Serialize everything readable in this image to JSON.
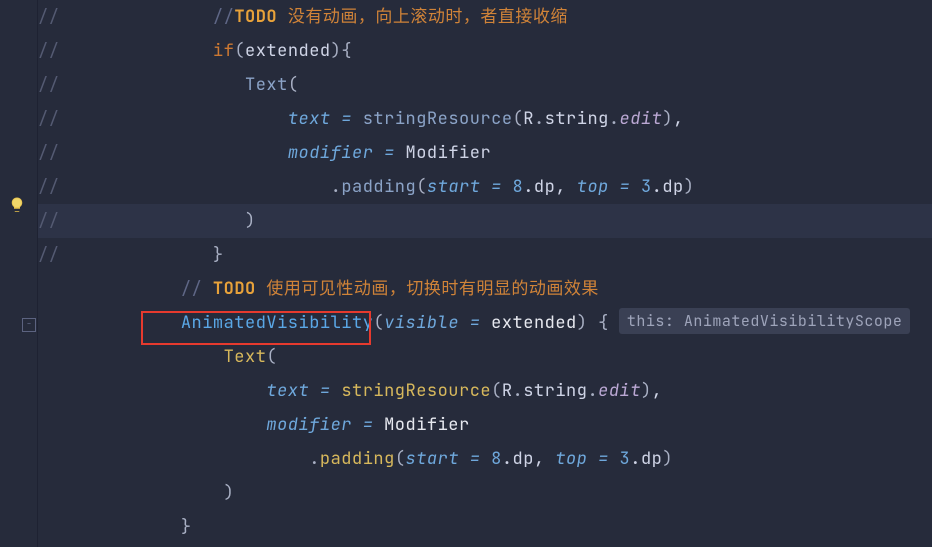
{
  "gutter_marker": "//",
  "hint": {
    "prefix": "this:",
    "type": "AnimatedVisibilityScope"
  },
  "code": {
    "l1": {
      "c1": "//",
      "todo": "TODO",
      "cn": " 没有动画，向上滚动时，者直接收缩"
    },
    "l2": {
      "kw": "if",
      "p1": "(",
      "id": "extended",
      "p2": ")",
      "br": "{"
    },
    "l3": {
      "fn": "Text",
      "p": "("
    },
    "l4": {
      "param": "text =",
      "fn": "stringResource",
      "p1": "(",
      "a": "R",
      "d1": ".",
      "b": "string",
      "d2": ".",
      "c": "edit",
      "p2": ")",
      "comma": ","
    },
    "l5": {
      "param": "modifier =",
      "id": "Modifier"
    },
    "l6": {
      "d": ".",
      "fn": "padding",
      "p1": "(",
      "a1": "start =",
      "v1": "8",
      "dp1": ".dp",
      "c": ",",
      "a2": "top =",
      "v2": "3",
      "dp2": ".dp",
      "p2": ")"
    },
    "l7": {
      "p": ")"
    },
    "l8": {
      "br": "}"
    },
    "l9": {
      "c1": "//",
      "todo": "TODO",
      "cn": " 使用可见性动画，切换时有明显的动画效果"
    },
    "l10": {
      "fn": "AnimatedVisibility",
      "p1": "(",
      "param": "visible =",
      "id": "extended",
      "p2": ")",
      "br": "{"
    },
    "l11": {
      "fn": "Text",
      "p": "("
    },
    "l12": {
      "param": "text =",
      "fn": "stringResource",
      "p1": "(",
      "a": "R",
      "d1": ".",
      "b": "string",
      "d2": ".",
      "c": "edit",
      "p2": ")",
      "comma": ","
    },
    "l13": {
      "param": "modifier =",
      "id": "Modifier"
    },
    "l14": {
      "d": ".",
      "fn": "padding",
      "p1": "(",
      "a1": "start =",
      "v1": "8",
      "dp1": ".dp",
      "c": ",",
      "a2": "top =",
      "v2": "3",
      "dp2": ".dp",
      "p2": ")"
    },
    "l15": {
      "p": ")"
    },
    "l16": {
      "br": "}"
    }
  }
}
